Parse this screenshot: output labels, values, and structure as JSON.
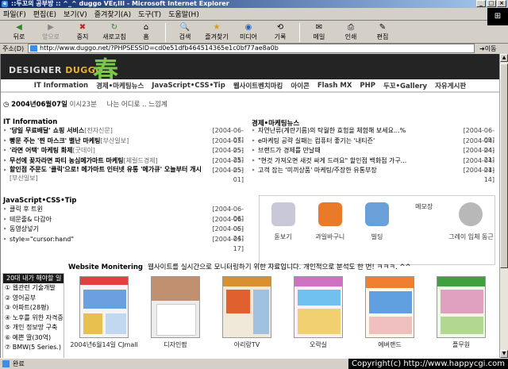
{
  "window": {
    "title": "::두꼬의 공부방 :: ^_^ duggo VEr,III - Microsoft Internet Explorer"
  },
  "menu": [
    "파일(F)",
    "편집(E)",
    "보기(V)",
    "즐겨찾기(A)",
    "도구(T)",
    "도움말(H)"
  ],
  "toolbar": {
    "back": "뒤로",
    "forward": "앞으로",
    "stop": "중지",
    "refresh": "새로고침",
    "home": "홈",
    "search": "검색",
    "favorites": "즐겨찾기",
    "media": "미디어",
    "history": "기록",
    "mail": "메일",
    "print": "인쇄",
    "edit": "편집"
  },
  "address": {
    "label": "주소(D)",
    "url": "http://www.duggo.net/?PHPSESSID=cd0e51dfb464514365e1c0bf77ae8a0b",
    "go": "이동"
  },
  "site": {
    "logo_prefix": "DESIGNER ",
    "logo_brand": "DUGGO",
    "logo_han": "春",
    "nav": [
      "IT Information",
      "경제•마케팅뉴스",
      "JavaScript•CSS•Tip",
      "웹사이트벤치마킹",
      "아이콘",
      "Flash MX",
      "PHP",
      "두꼬•Gallery",
      "자유게시판"
    ],
    "date": "2004년06월07일",
    "time": "이시23분",
    "quote": "나는 어디로 .. 느낌계"
  },
  "it": {
    "title": "IT Information",
    "items": [
      {
        "text": "'당일 무료배달' 쇼핑 서비스",
        "src": "[전자신문]",
        "date": "[2004-06-07]"
      },
      {
        "text": "빵문 주는 '찐 마스크' 별난 마케팅",
        "src": "[부산일보]",
        "date": "[2004-05-25]"
      },
      {
        "text": "'라면 어택' 마케팅 화제",
        "src": "[굿데이]",
        "date": "[2004-05-25]"
      },
      {
        "text": "무선에 꽂자라면 파티 농심메가마트 마케팅",
        "src": "[체럴드경제]",
        "date": "[2004-05-25]"
      },
      {
        "text": "할인점 주문도 '클릭'으로! 메가마트 인터넷 유통 '메가큐' 오늘부터 개시",
        "src": "[부산일보]",
        "date": "[2004-05-01]"
      }
    ]
  },
  "econ": {
    "title": "경제•마케팅뉴스",
    "items": [
      {
        "text": "자연난류(계란기름)의 탁월한 효험을 체험해 보세요...%",
        "date": "[2004-06-09]"
      },
      {
        "text": "e마케팅 공략 실패는 컴퓨터 좋기는 '내티즌'",
        "date": "[2004-04-24]"
      },
      {
        "text": "브랜드가 경제를 만날때",
        "date": "[2004-04-21]"
      },
      {
        "text": "\"현것 가져오면 새것 싸게 드려요\" 할인점 백화점 가구...",
        "date": "[2004-04-21]"
      },
      {
        "text": "고객 잡는 '미끼상품' 마케팅/주장한 유통부장",
        "date": "[2004-04-14]"
      }
    ]
  },
  "js": {
    "title": "JavaScript•CSS•Tip",
    "items": [
      {
        "text": "클릭 후 트윈",
        "date": "[2004-06-06]"
      },
      {
        "text": "테문줄& 다갑아",
        "date": "[2004-06-06]"
      },
      {
        "text": "동영상넣기",
        "date": "[2004-05-24]"
      },
      {
        "text": "style=\"cursor:hand\"",
        "date": "[2004-05-17]"
      }
    ]
  },
  "icons": [
    {
      "label": "돋보기",
      "color": "#c8c8d8"
    },
    {
      "label": "과일바구니",
      "color": "#e87a2a"
    },
    {
      "label": "빌딩",
      "color": "#6aa0d8"
    },
    {
      "label": "메모장",
      "color": "#ffffff"
    },
    {
      "label": "그레이 입체 동근",
      "color": "#b8b8b8"
    }
  ],
  "monitor": {
    "title": "Website Monitering",
    "desc": "웹사이트를 실시간으로 모니터링하기 위한 자료입니다. 개인적으로 분석도 한 번! ㅋㅋㅋ. ^^",
    "shots": [
      {
        "caption": "2004년6월14일 CJmall"
      },
      {
        "caption": "디자인팜"
      },
      {
        "caption": "아리랑TV"
      },
      {
        "caption": "오락실"
      },
      {
        "caption": "에버랜드"
      },
      {
        "caption": "플무원"
      }
    ]
  },
  "sidebox": {
    "title": "20대 내가 해야할 일",
    "items": [
      "① 웹관련 기술개발",
      "② 영어공부",
      "③ 아파트(28평)",
      "④ 노후를 위한 자격증",
      "⑤ 개인 정보망 구축",
      "⑥ 예쁜 딸(30억)",
      "⑦ BMW(5 Series.)"
    ]
  },
  "status": {
    "text": "완료",
    "copyright": "Copyright(c) http://www.happycgi.com"
  }
}
